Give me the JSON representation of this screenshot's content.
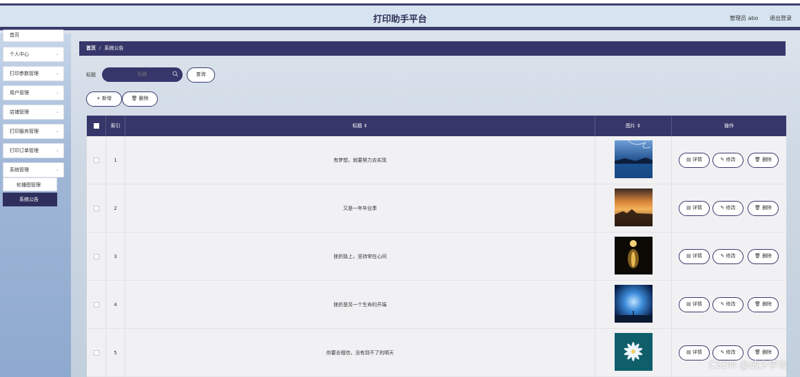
{
  "header": {
    "title": "打印助手平台",
    "user_label": "管理员 abo",
    "logout_label": "退出登录"
  },
  "sidebar": {
    "items": [
      {
        "label": "首页"
      },
      {
        "label": "个人中心"
      },
      {
        "label": "打印参数管理"
      },
      {
        "label": "用户管理"
      },
      {
        "label": "店铺管理"
      },
      {
        "label": "打印服务管理"
      },
      {
        "label": "打印订单管理"
      },
      {
        "label": "系统管理"
      }
    ],
    "submenu": [
      {
        "label": "轮播图管理"
      },
      {
        "label": "系统公告",
        "active": true
      }
    ]
  },
  "breadcrumb": {
    "home": "首页",
    "separator": "/",
    "current": "系统公告"
  },
  "search": {
    "label": "标题",
    "placeholder": "标题",
    "button": "查询"
  },
  "actions": {
    "add": "+ 新增",
    "delete": "删除"
  },
  "table": {
    "columns": [
      "索引",
      "标题 ⇕",
      "图片 ⇕",
      "操作"
    ],
    "rows": [
      {
        "index": "1",
        "title": "有梦想，就要努力去实现"
      },
      {
        "index": "2",
        "title": "又是一年毕业季"
      },
      {
        "index": "3",
        "title": "挫折路上，坚持常在心间"
      },
      {
        "index": "4",
        "title": "挫折是另一个生命的开端"
      },
      {
        "index": "5",
        "title": "你要去相信，没有到不了的明天"
      }
    ],
    "row_actions": {
      "detail": "详情",
      "edit": "修改",
      "delete": "删除"
    }
  },
  "watermark": "CSDN @战少学长",
  "colors": {
    "accent": "#36366a",
    "header_bg": "#d6e4f1"
  }
}
